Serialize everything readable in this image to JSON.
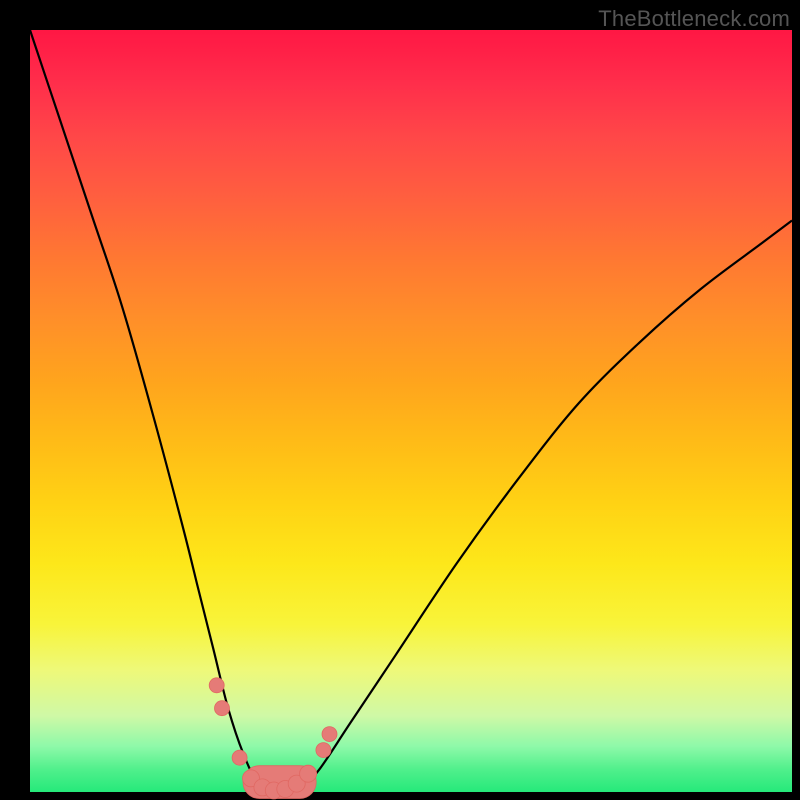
{
  "watermark": "TheBottleneck.com",
  "chart_data": {
    "type": "line",
    "title": "",
    "xlabel": "",
    "ylabel": "",
    "xlim": [
      0,
      100
    ],
    "ylim": [
      0,
      100
    ],
    "grid": false,
    "background_gradient": {
      "top": "#ff1744",
      "mid": "#ffd400",
      "bottom": "#25e97a"
    },
    "series": [
      {
        "name": "bottleneck-curve",
        "x": [
          0,
          4,
          8,
          12,
          16,
          20,
          22,
          24,
          26,
          28,
          30,
          32,
          34,
          36,
          38,
          42,
          48,
          56,
          64,
          72,
          80,
          88,
          96,
          100
        ],
        "y": [
          100,
          88,
          76,
          64,
          50,
          35,
          27,
          19,
          11,
          5,
          1,
          0,
          0,
          1,
          3,
          9,
          18,
          30,
          41,
          51,
          59,
          66,
          72,
          75
        ]
      }
    ],
    "markers": {
      "name": "highlight-dots",
      "color": "#e57b77",
      "points": [
        {
          "x": 24.5,
          "y": 14
        },
        {
          "x": 25.2,
          "y": 11
        },
        {
          "x": 27.5,
          "y": 4.5
        },
        {
          "x": 29.0,
          "y": 1.8
        },
        {
          "x": 30.5,
          "y": 0.6
        },
        {
          "x": 32.0,
          "y": 0.2
        },
        {
          "x": 33.5,
          "y": 0.4
        },
        {
          "x": 35.0,
          "y": 1.1
        },
        {
          "x": 36.5,
          "y": 2.4
        },
        {
          "x": 38.5,
          "y": 5.5
        },
        {
          "x": 39.3,
          "y": 7.6
        }
      ]
    }
  }
}
